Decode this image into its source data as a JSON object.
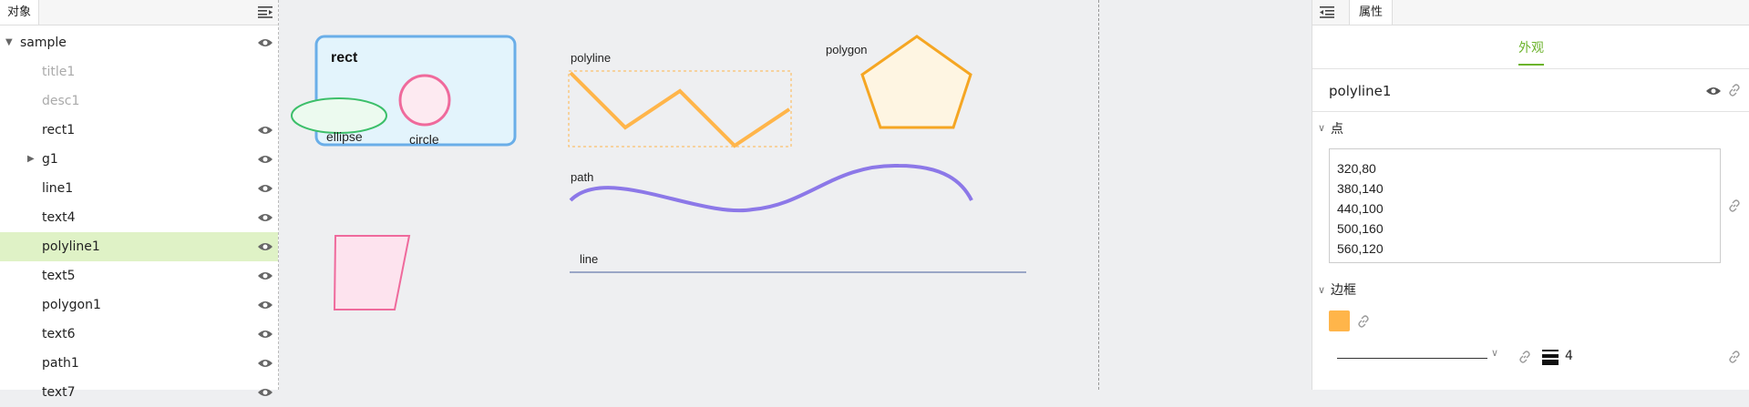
{
  "left_panel": {
    "tab_label": "对象",
    "tree": [
      {
        "label": "sample",
        "level": 0,
        "caret": "expanded",
        "visible_icon": true,
        "dim": false,
        "selected": false
      },
      {
        "label": "title1",
        "level": 1,
        "caret": "none",
        "visible_icon": false,
        "dim": true,
        "selected": false
      },
      {
        "label": "desc1",
        "level": 1,
        "caret": "none",
        "visible_icon": false,
        "dim": true,
        "selected": false
      },
      {
        "label": "rect1",
        "level": 1,
        "caret": "none",
        "visible_icon": true,
        "dim": false,
        "selected": false
      },
      {
        "label": "g1",
        "level": 1,
        "caret": "collapsed",
        "visible_icon": true,
        "dim": false,
        "selected": false
      },
      {
        "label": "line1",
        "level": 1,
        "caret": "none",
        "visible_icon": true,
        "dim": false,
        "selected": false
      },
      {
        "label": "text4",
        "level": 1,
        "caret": "none",
        "visible_icon": true,
        "dim": false,
        "selected": false
      },
      {
        "label": "polyline1",
        "level": 1,
        "caret": "none",
        "visible_icon": true,
        "dim": false,
        "selected": true
      },
      {
        "label": "text5",
        "level": 1,
        "caret": "none",
        "visible_icon": true,
        "dim": false,
        "selected": false
      },
      {
        "label": "polygon1",
        "level": 1,
        "caret": "none",
        "visible_icon": true,
        "dim": false,
        "selected": false
      },
      {
        "label": "text6",
        "level": 1,
        "caret": "none",
        "visible_icon": true,
        "dim": false,
        "selected": false
      },
      {
        "label": "path1",
        "level": 1,
        "caret": "none",
        "visible_icon": true,
        "dim": false,
        "selected": false
      },
      {
        "label": "text7",
        "level": 1,
        "caret": "none",
        "visible_icon": true,
        "dim": false,
        "selected": false
      }
    ]
  },
  "canvas": {
    "rect_title": "rect",
    "ellipse_label": "ellipse",
    "circle_label": "circle",
    "polyline_label": "polyline",
    "polygon_label": "polygon",
    "path_label": "path",
    "line_label": "line",
    "colors": {
      "rect_fill": "#e3f4fc",
      "rect_stroke": "#6aaee8",
      "ellipse_fill": "#ecfaef",
      "ellipse_stroke": "#3cbf6a",
      "circle_fill": "#fdeaf1",
      "circle_stroke": "#ef6a9c",
      "polyline_stroke": "#ffb54a",
      "polygon_fill": "#fef5e2",
      "polygon_stroke": "#f5a623",
      "path_stroke": "#8c78e8",
      "line_stroke": "#9aa6c6",
      "parallelogram_fill": "#fde3ee",
      "parallelogram_stroke": "#ef6a9c"
    }
  },
  "right_panel": {
    "tab_label": "属性",
    "subtab_label": "外观",
    "object_name": "polyline1",
    "points_section": "点",
    "points_value": "320,80\n380,140\n440,100\n500,160\n560,120",
    "border_section": "边框",
    "stroke_color": "#ffb54a",
    "stroke_width": "4",
    "accent": "#6cb32c"
  }
}
